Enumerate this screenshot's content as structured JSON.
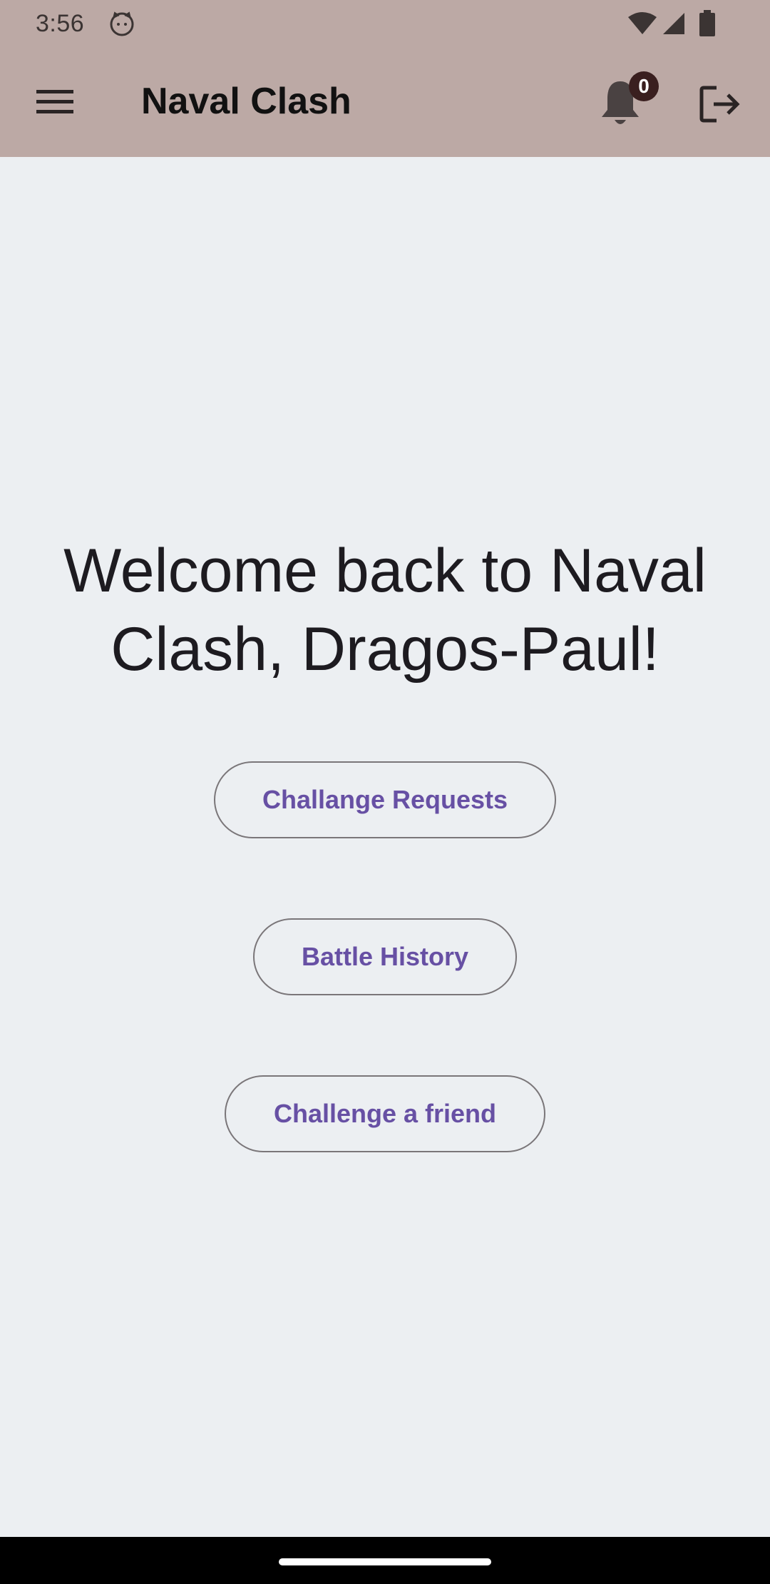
{
  "status_bar": {
    "time": "3:56",
    "icons": [
      "cat-icon",
      "wifi-icon",
      "signal-icon",
      "battery-icon"
    ]
  },
  "app_bar": {
    "title": "Naval Clash",
    "menu_icon": "hamburger-menu-icon",
    "notification_icon": "bell-icon",
    "notification_count": "0",
    "logout_icon": "logout-icon",
    "background_color": "#bca9a5"
  },
  "main": {
    "welcome_text": "Welcome back to Naval Clash, Dragos-Paul!",
    "buttons": [
      {
        "label": "Challange Requests"
      },
      {
        "label": "Battle History"
      },
      {
        "label": "Challenge a friend"
      }
    ],
    "accent_color": "#6750a4",
    "background_color": "#eceff2"
  }
}
